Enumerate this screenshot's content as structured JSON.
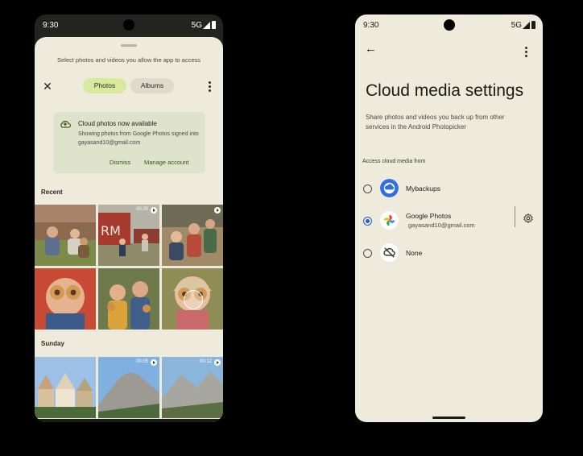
{
  "picker": {
    "status": {
      "time": "9:30",
      "network": "5G"
    },
    "subtitle": "Select photos and videos you allow the app to access",
    "close_icon": "close-icon",
    "tabs": {
      "photos": "Photos",
      "albums": "Albums"
    },
    "banner": {
      "title": "Cloud photos now available",
      "body": "Showing photos from Google Photos signed into gayasand10@gmail.com",
      "dismiss": "Dismiss",
      "manage": "Manage account"
    },
    "sections": {
      "recent": "Recent",
      "sunday": "Sunday"
    },
    "recent_tiles": [
      {
        "scene": "kids-on-grass",
        "duration": ""
      },
      {
        "scene": "red-barn",
        "duration": "00:25"
      },
      {
        "scene": "family-group",
        "duration": ""
      },
      {
        "scene": "donut-eyes-boy",
        "duration": ""
      },
      {
        "scene": "kids-with-donuts",
        "duration": ""
      },
      {
        "scene": "donut-eyes-girl",
        "duration": ""
      }
    ],
    "sunday_tiles": [
      {
        "scene": "painted-houses",
        "duration": ""
      },
      {
        "scene": "half-dome",
        "duration": "00:05"
      },
      {
        "scene": "valley-view",
        "duration": "00:12"
      }
    ]
  },
  "settings": {
    "status": {
      "time": "9:30",
      "network": "5G"
    },
    "title": "Cloud media settings",
    "description": "Share photos and videos you back up from other services in the Android Photopicker",
    "section_label": "Access cloud media from",
    "options": [
      {
        "label": "Mybackups",
        "sub": "",
        "selected": false,
        "icon": "cloud-icon"
      },
      {
        "label": "Google Photos",
        "sub": "gayasand10@gmail.com",
        "selected": true,
        "icon": "google-photos-icon"
      },
      {
        "label": "None",
        "sub": "",
        "selected": false,
        "icon": "cloud-off-icon"
      }
    ],
    "colors": {
      "accent": "#1f5fd1",
      "background": "#efebdc"
    }
  }
}
